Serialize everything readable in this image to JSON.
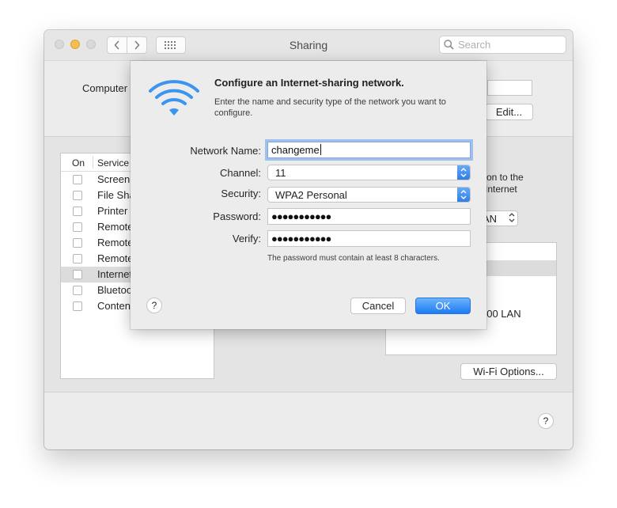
{
  "window": {
    "title": "Sharing",
    "search_placeholder": "Search",
    "computer_label": "Computer",
    "edit_button": "Edit...",
    "wifi_options_button": "Wi-Fi Options...",
    "help_label": "?"
  },
  "services": {
    "header_on": "On",
    "header_service": "Service",
    "items": [
      {
        "label": "Screen",
        "checked": false,
        "selected": false
      },
      {
        "label": "File Sha",
        "checked": false,
        "selected": false
      },
      {
        "label": "Printer",
        "checked": false,
        "selected": false
      },
      {
        "label": "Remote",
        "checked": false,
        "selected": false
      },
      {
        "label": "Remote",
        "checked": false,
        "selected": false
      },
      {
        "label": "Remote",
        "checked": false,
        "selected": false
      },
      {
        "label": "Internet",
        "checked": false,
        "selected": true
      },
      {
        "label": "Bluetoo",
        "checked": false,
        "selected": false
      },
      {
        "label": "Content",
        "checked": false,
        "selected": false
      }
    ]
  },
  "right_panel": {
    "line1": "ction to the",
    "line2": "e Internet",
    "share_from_popup": "AN",
    "port_text": "000 LAN"
  },
  "sheet": {
    "title": "Configure an Internet-sharing network.",
    "description": "Enter the name and security type of the network you want to configure.",
    "network_name_label": "Network Name:",
    "network_name_value": "changeme",
    "channel_label": "Channel:",
    "channel_value": "11",
    "security_label": "Security:",
    "security_value": "WPA2 Personal",
    "password_label": "Password:",
    "password_dots": "●●●●●●●●●●●",
    "verify_label": "Verify:",
    "verify_dots": "●●●●●●●●●●●",
    "hint": "The password must contain at least 8 characters.",
    "help_label": "?",
    "cancel_button": "Cancel",
    "ok_button": "OK"
  },
  "colors": {
    "accent": "#1c7bf4",
    "wifi_icon": "#3b95f0",
    "window_bg": "#ececec"
  }
}
